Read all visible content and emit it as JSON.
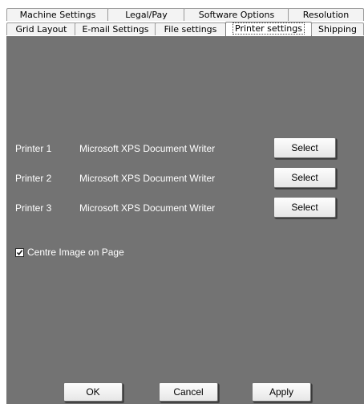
{
  "tabs_row1": [
    "Machine Settings",
    "Legal/Pay",
    "Software Options",
    "Resolution"
  ],
  "tabs_row2": [
    "Grid Layout",
    "E-mail Settings",
    "File settings",
    "Printer settings",
    "Shipping"
  ],
  "active_tab": "Printer settings",
  "printers": [
    {
      "label": "Printer 1",
      "name": "Microsoft XPS Document Writer",
      "button": "Select"
    },
    {
      "label": "Printer 2",
      "name": "Microsoft XPS Document Writer",
      "button": "Select"
    },
    {
      "label": "Printer 3",
      "name": "Microsoft XPS Document Writer",
      "button": "Select"
    }
  ],
  "centre_image": {
    "label": "Centre Image on Page",
    "checked": true
  },
  "footer": {
    "ok": "OK",
    "cancel": "Cancel",
    "apply": "Apply"
  },
  "colors": {
    "panel_bg": "#737373",
    "text": "#ffffff"
  }
}
